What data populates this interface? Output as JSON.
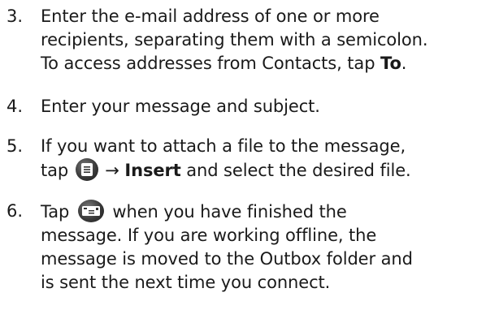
{
  "steps": [
    {
      "number": "3.",
      "lines": [
        "Enter the e-mail address of one or more",
        "recipients, separating them with a semicolon."
      ],
      "line3_prefix": "To access addresses from Contacts, tap ",
      "line3_bold": "To",
      "line3_suffix": "."
    },
    {
      "number": "4.",
      "text": "Enter your message and subject."
    },
    {
      "number": "5.",
      "line1": "If you want to attach a file to the message,",
      "line2_prefix": "tap ",
      "line2_icon": "menu-icon",
      "line2_arrow": "→",
      "line2_bold": "Insert",
      "line2_suffix": " and select the desired file."
    },
    {
      "number": "6.",
      "line1_prefix": "Tap ",
      "line1_icon": "send-mail-icon",
      "line1_suffix": " when you have finished the",
      "lines": [
        "message. If you are working offline, the",
        "message is moved to the Outbox folder and",
        "is sent the next time you connect."
      ]
    }
  ]
}
